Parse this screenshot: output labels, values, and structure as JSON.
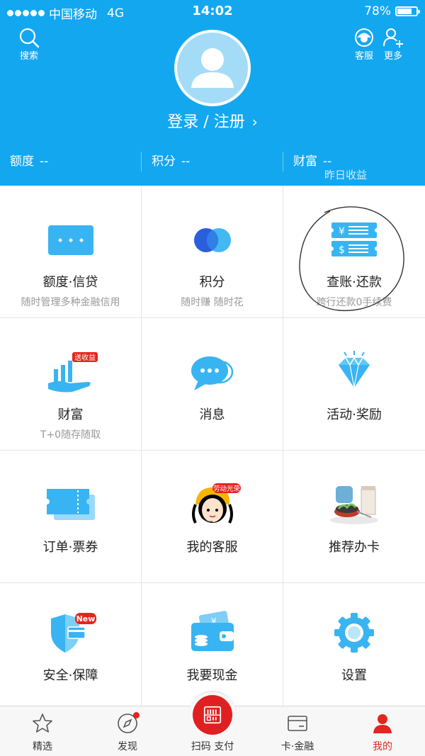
{
  "status_bar": {
    "carrier": "中国移动",
    "network": "4G",
    "time": "14:02",
    "battery": "78%",
    "battery_level": 0.78
  },
  "header": {
    "search_label": "搜索",
    "service_label": "客服",
    "more_label": "更多",
    "login_label": "登录 / 注册",
    "login_chevron": "›",
    "stats": [
      {
        "label": "额度",
        "value": "--"
      },
      {
        "label": "积分",
        "value": "--"
      },
      {
        "label": "财富",
        "value": "--",
        "sub": "昨日收益"
      }
    ]
  },
  "grid": [
    {
      "title": "额度·信贷",
      "sub": "随时管理多种金融信用",
      "icon": "credit-card-icon"
    },
    {
      "title": "积分",
      "sub": "随时赚 随时花",
      "icon": "points-icon"
    },
    {
      "title": "查账·还款",
      "sub": "跨行还款0手续费",
      "icon": "bill-icon"
    },
    {
      "title": "财富",
      "sub": "T+0随存随取",
      "icon": "wealth-icon",
      "badge": "送收益"
    },
    {
      "title": "消息",
      "sub": "",
      "icon": "message-icon"
    },
    {
      "title": "活动·奖励",
      "sub": "",
      "icon": "diamond-icon"
    },
    {
      "title": "订单·票券",
      "sub": "",
      "icon": "ticket-icon"
    },
    {
      "title": "我的客服",
      "sub": "",
      "icon": "customer-service-icon",
      "badge": "劳动光荣"
    },
    {
      "title": "推荐办卡",
      "sub": "",
      "icon": "recommend-card-icon"
    },
    {
      "title": "安全·保障",
      "sub": "",
      "icon": "shield-icon",
      "badge": "New"
    },
    {
      "title": "我要现金",
      "sub": "",
      "icon": "wallet-icon"
    },
    {
      "title": "设置",
      "sub": "",
      "icon": "gear-icon"
    }
  ],
  "tabbar": {
    "tabs": [
      {
        "label": "精选",
        "icon": "star-icon"
      },
      {
        "label": "发现",
        "icon": "compass-icon"
      },
      {
        "label": "扫码 支付",
        "icon": "scan-icon"
      },
      {
        "label": "卡·金融",
        "icon": "card-icon"
      },
      {
        "label": "我的",
        "icon": "user-icon"
      }
    ]
  },
  "colors": {
    "brand": "#13a7f0",
    "accent_red": "#e4251d",
    "icon_blue": "#39b4f2"
  }
}
